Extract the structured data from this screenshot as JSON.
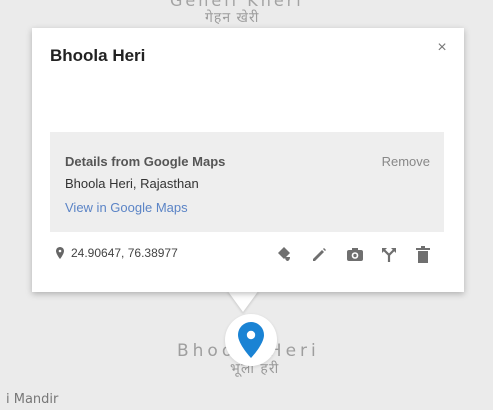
{
  "map": {
    "top_label_en": "Geneli Kheri",
    "top_label_hi": "गेहन खेरी",
    "place_label_en": "Bhoola Heri",
    "place_label_hi": "भूला हरी",
    "nearby_label": "i Mandir"
  },
  "popup": {
    "title": "Bhoola Heri",
    "close_symbol": "×",
    "details": {
      "heading": "Details from Google Maps",
      "remove_label": "Remove",
      "address": "Bhoola Heri, Rajasthan",
      "link_label": "View in Google Maps"
    },
    "coordinates": "24.90647, 76.38977",
    "actions": [
      "style-icon",
      "edit-icon",
      "camera-icon",
      "directions-icon",
      "delete-icon"
    ]
  },
  "colors": {
    "pin": "#1a83d4",
    "link": "#5b84c6",
    "icon": "#6f6f6f"
  }
}
